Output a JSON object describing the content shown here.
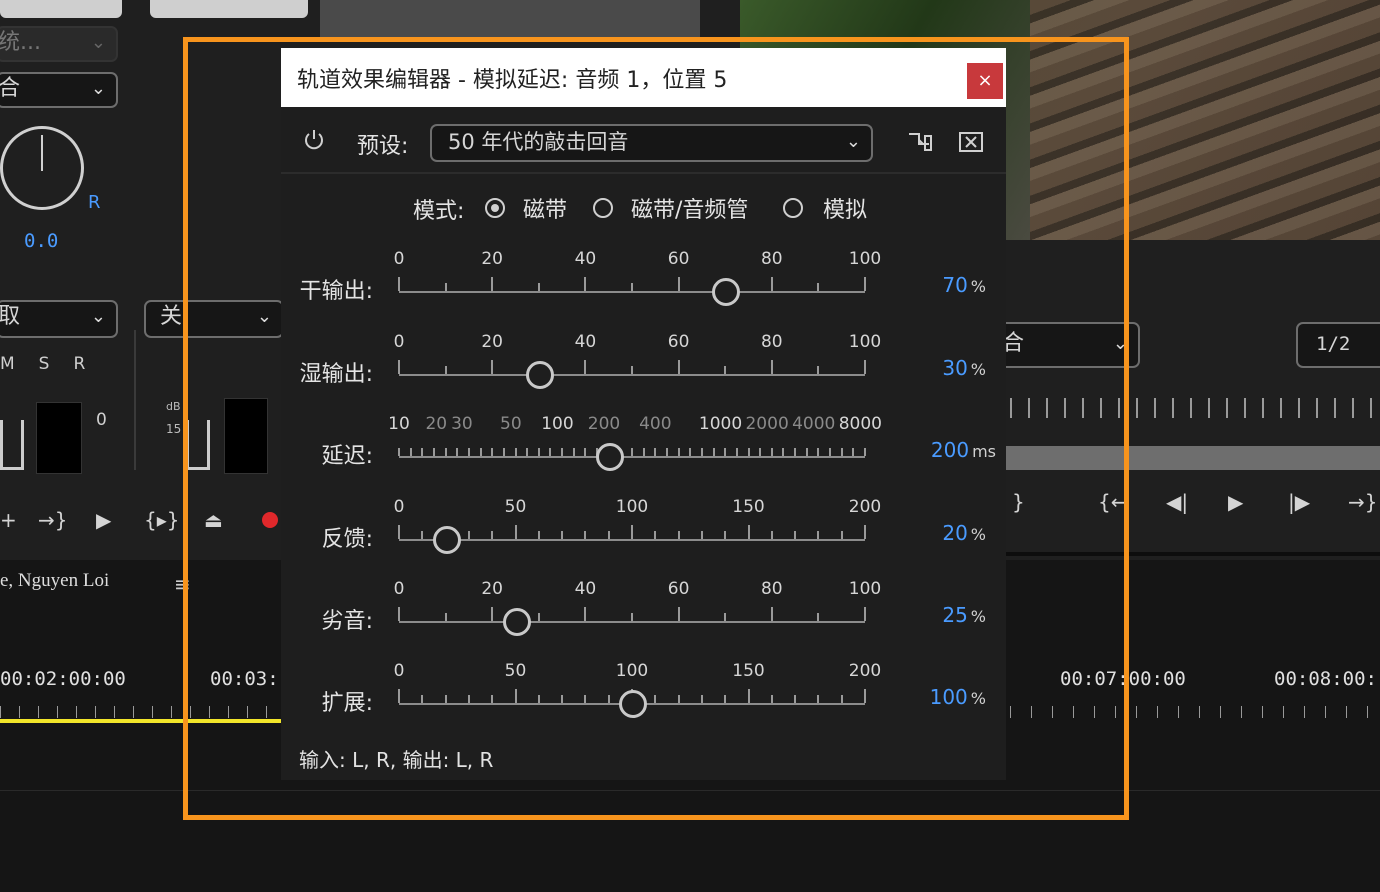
{
  "background": {
    "left_panel": {
      "dropdown_1": "统...",
      "dropdown_2": "合",
      "pan_value": "0.0",
      "pan_r": "R",
      "dropdown_3": "取",
      "dropdown_4": "关",
      "msr": [
        "M",
        "S",
        "R"
      ],
      "meter_zero": "0",
      "db_label": "dB",
      "db_15": "15",
      "track_name": "e, Nguyen Loi"
    },
    "right_panel": {
      "dropdown": "合",
      "page_indicator": "1/2"
    },
    "timeline": {
      "timecodes": [
        "00:02:00:00",
        "00:03:",
        "00:07:00:00",
        "00:08:00:"
      ]
    }
  },
  "dialog": {
    "title": "轨道效果编辑器 - 模拟延迟: 音频 1，位置 5",
    "close": "×",
    "preset_label": "预设:",
    "preset_value": "50 年代的敲击回音",
    "mode_label": "模式:",
    "modes": [
      {
        "label": "磁带",
        "selected": true
      },
      {
        "label": "磁带/音频管",
        "selected": false
      },
      {
        "label": "模拟",
        "selected": false
      }
    ],
    "sliders": [
      {
        "label": "干输出:",
        "ticks": [
          "0",
          "20",
          "40",
          "60",
          "80",
          "100"
        ],
        "value": "70",
        "unit": "%",
        "position": 0.7
      },
      {
        "label": "湿输出:",
        "ticks": [
          "0",
          "20",
          "40",
          "60",
          "80",
          "100"
        ],
        "value": "30",
        "unit": "%",
        "position": 0.3
      },
      {
        "label": "延迟:",
        "ticks": [
          "10",
          "20",
          "30",
          "50",
          "100",
          "200",
          "400",
          "1000",
          "2000",
          "4000",
          "8000"
        ],
        "value": "200",
        "unit": "ms",
        "position": 0.45
      },
      {
        "label": "反馈:",
        "ticks": [
          "0",
          "50",
          "100",
          "150",
          "200"
        ],
        "value": "20",
        "unit": "%",
        "position": 0.1
      },
      {
        "label": "劣音:",
        "ticks": [
          "0",
          "20",
          "40",
          "60",
          "80",
          "100"
        ],
        "value": "25",
        "unit": "%",
        "position": 0.25
      },
      {
        "label": "扩展:",
        "ticks": [
          "0",
          "50",
          "100",
          "150",
          "200"
        ],
        "value": "100",
        "unit": "%",
        "position": 0.5
      }
    ],
    "io_text": "输入: L, R, 输出: L, R"
  },
  "colors": {
    "highlight": "#f7941d",
    "value_blue": "#4a9bff",
    "close_red": "#c8393c",
    "record_red": "#e0282b"
  }
}
